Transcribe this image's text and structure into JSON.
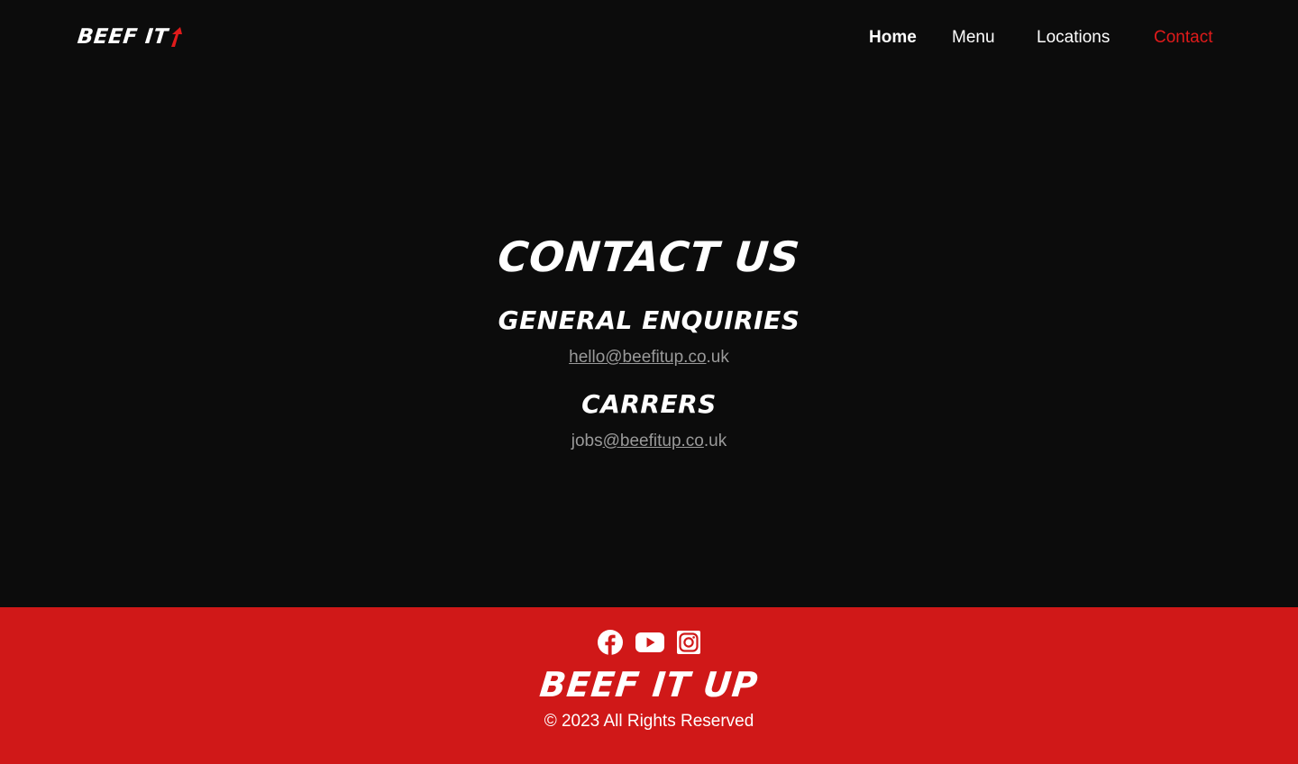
{
  "header": {
    "logo_text": "BEEF IT",
    "nav": [
      {
        "label": "Home"
      },
      {
        "label": "Menu"
      },
      {
        "label": "Locations"
      },
      {
        "label": "Contact"
      }
    ]
  },
  "main": {
    "title": "CONTACT US",
    "general": {
      "heading": "GENERAL ENQUIRIES",
      "email_link": "hello@beefitup.co",
      "email_suffix": ".uk"
    },
    "careers": {
      "heading": "CARRERS",
      "email_prefix": "jobs",
      "email_link": "@beefitup.co",
      "email_suffix": ".uk"
    }
  },
  "footer": {
    "socials": [
      {
        "icon": "facebook-icon"
      },
      {
        "icon": "youtube-icon"
      },
      {
        "icon": "instagram-icon"
      }
    ],
    "brand": "BEEF IT UP",
    "copyright": "© 2023 All Rights Reserved"
  },
  "colors": {
    "background": "#0c0c0c",
    "accent": "#d01818",
    "active_nav": "#e01b1b",
    "muted_text": "#9a9a9a"
  }
}
